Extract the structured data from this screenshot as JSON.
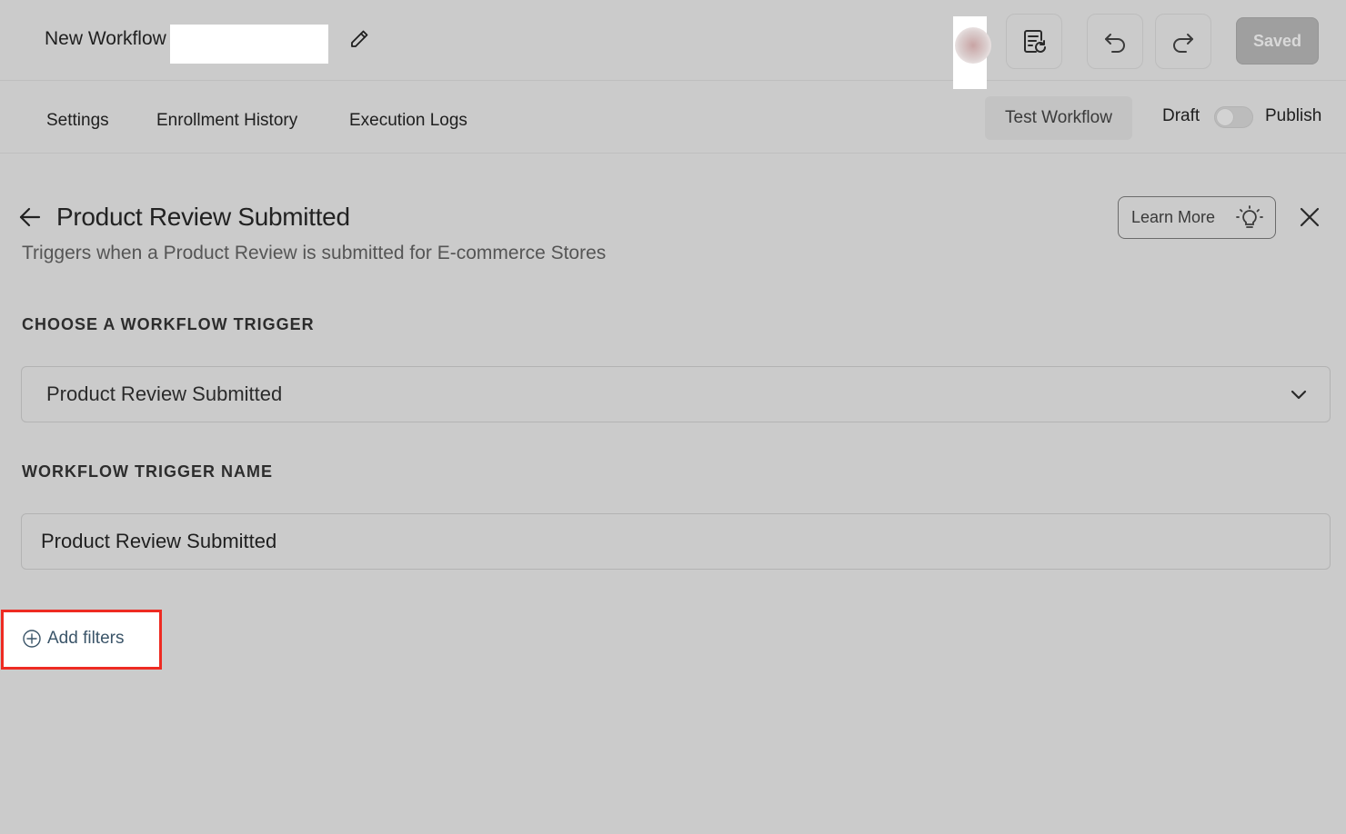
{
  "header": {
    "workflow_title": "New Workflow",
    "saved_label": "Saved"
  },
  "tabs": [
    {
      "label": "Settings"
    },
    {
      "label": "Enrollment History"
    },
    {
      "label": "Execution Logs"
    }
  ],
  "actions": {
    "test_workflow_label": "Test Workflow",
    "draft_label": "Draft",
    "publish_label": "Publish",
    "publish_state": "draft"
  },
  "panel": {
    "title": "Product Review Submitted",
    "description": "Triggers when a Product Review is submitted for E-commerce Stores",
    "learn_more_label": "Learn More"
  },
  "form": {
    "trigger_section_label": "CHOOSE A WORKFLOW TRIGGER",
    "trigger_selected": "Product Review Submitted",
    "trigger_name_section_label": "WORKFLOW TRIGGER NAME",
    "trigger_name_value": "Product Review Submitted",
    "add_filters_label": "Add filters"
  },
  "colors": {
    "highlight_border": "#ee2b22",
    "link_text": "#3b5569"
  }
}
